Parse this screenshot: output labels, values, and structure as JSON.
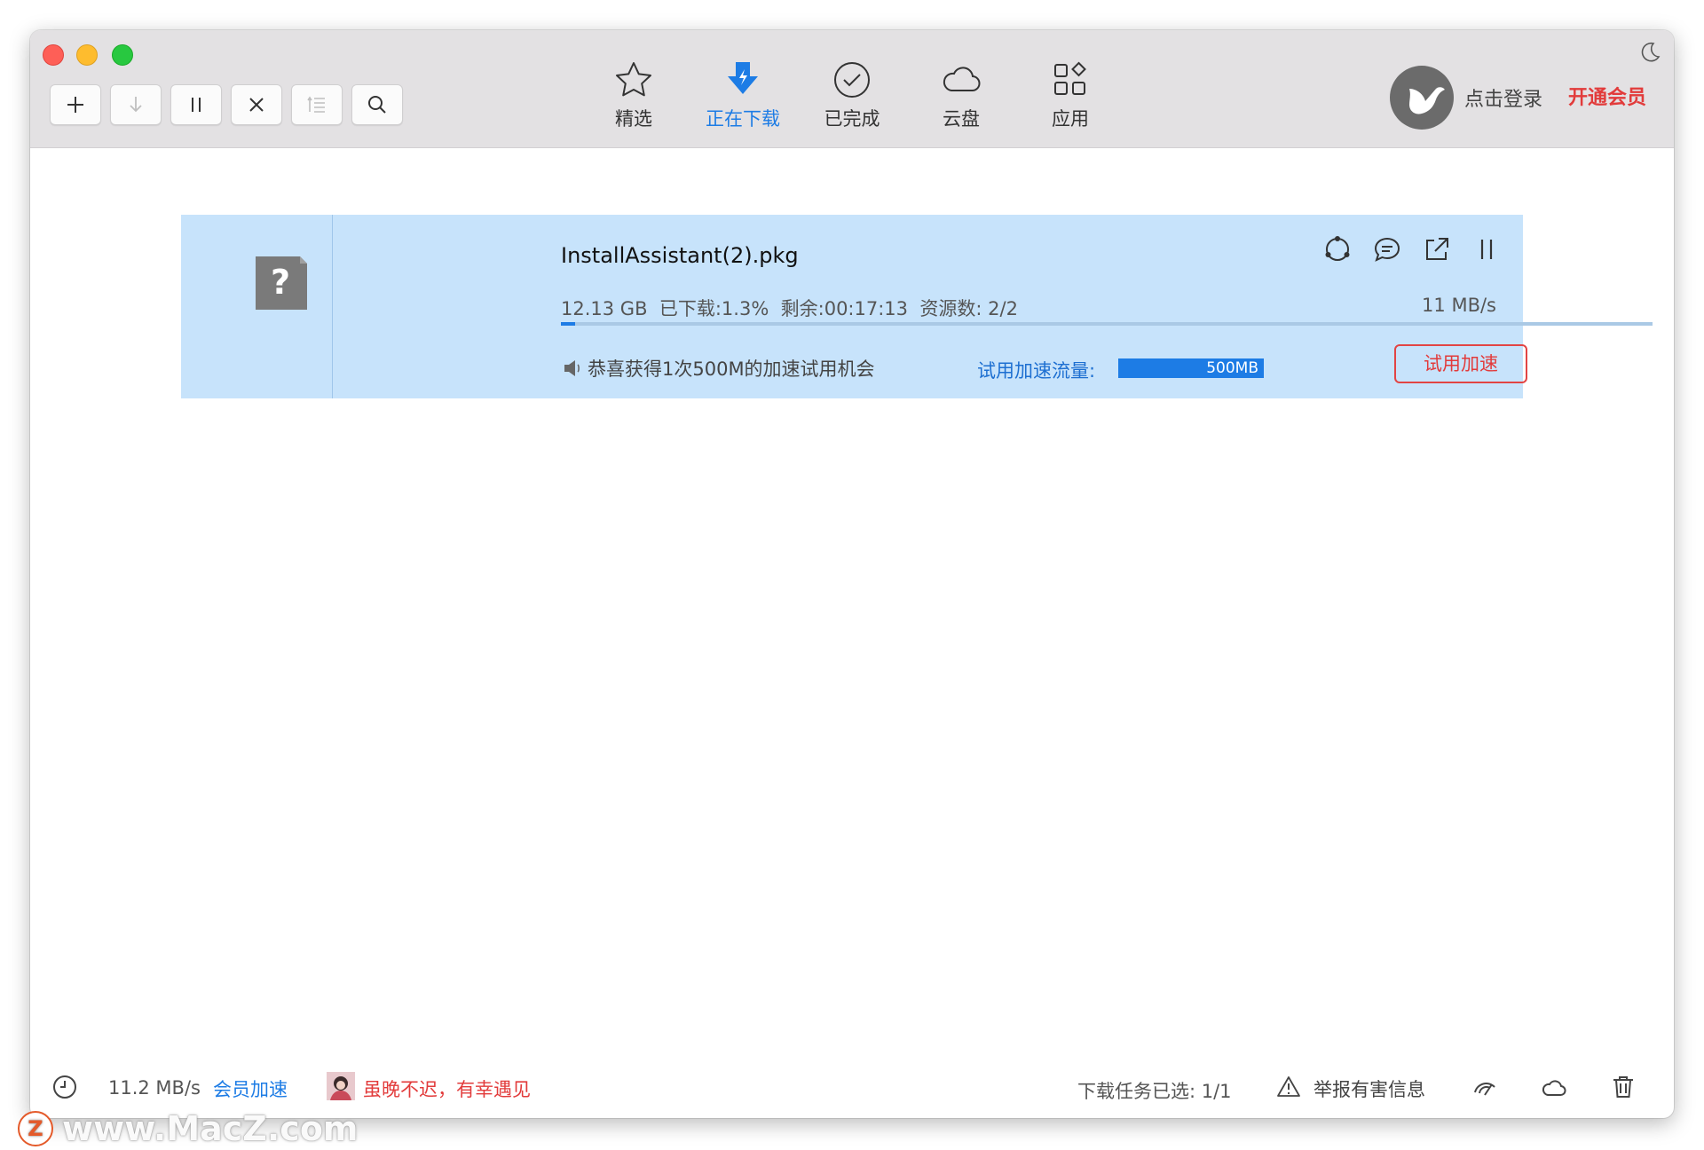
{
  "toolbar": {
    "buttons": [
      {
        "name": "new-task",
        "icon": "plus-icon"
      },
      {
        "name": "start",
        "icon": "download-arrow-icon"
      },
      {
        "name": "pause",
        "icon": "pause-icon"
      },
      {
        "name": "delete",
        "icon": "close-icon"
      },
      {
        "name": "sort",
        "icon": "list-sort-icon"
      },
      {
        "name": "search",
        "icon": "search-icon"
      }
    ],
    "tabs": [
      {
        "label": "精选",
        "icon": "star-icon"
      },
      {
        "label": "正在下载",
        "icon": "download-bolt-icon"
      },
      {
        "label": "已完成",
        "icon": "check-circle-icon"
      },
      {
        "label": "云盘",
        "icon": "cloud-icon"
      },
      {
        "label": "应用",
        "icon": "apps-icon"
      }
    ],
    "active_tab": "正在下载",
    "login_label": "点击登录",
    "vip_label": "开通会员"
  },
  "download": {
    "file_name": "InstallAssistant(2).pkg",
    "size": "12.13 GB",
    "downloaded": "已下载:1.3%",
    "remaining": "剩余:00:17:13",
    "sources": "资源数: 2/2",
    "speed": "11 MB/s",
    "progress_percent": 1.3,
    "promo_text": "恭喜获得1次500M的加速试用机会",
    "trial_label": "试用加速流量:",
    "trial_amount": "500MB",
    "trial_button": "试用加速"
  },
  "status_bar": {
    "total_speed": "11.2 MB/s",
    "vip_speed_link": "会员加速",
    "ad_text": "虽晚不迟，有幸遇见",
    "selected": "下载任务已选: 1/1",
    "report": "举报有害信息"
  },
  "watermark": {
    "logo": "Z",
    "text": "www.MacZ.com"
  },
  "colors": {
    "accent": "#1d7ce5",
    "vip_red": "#e23b3b",
    "item_bg": "#c7e3fb",
    "toolbar_bg": "#e3e1e3"
  }
}
